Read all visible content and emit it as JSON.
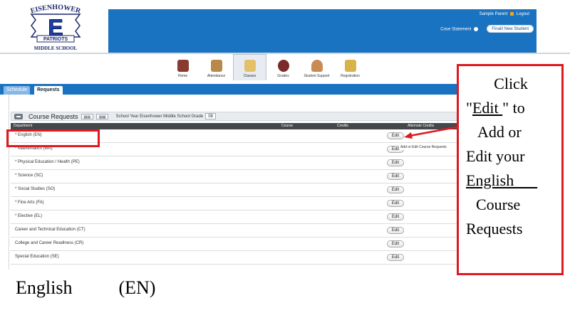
{
  "header": {
    "logo": {
      "name_top": "EISENHOWER",
      "mascot": "PATRIOTS",
      "name_bottom": "MIDDLE SCHOOL",
      "letter": "E"
    },
    "user": "Sample Parent",
    "logout": "Logout",
    "course_statement": "Cose Statement",
    "finalize_button": "Finalil New Student",
    "brand_color": "#1a73c1"
  },
  "nav": {
    "items": [
      {
        "label": "Home",
        "icon": "home-icon",
        "color": "#8a3b2f"
      },
      {
        "label": "Attendance",
        "icon": "attendance-icon",
        "color": "#b8894a"
      },
      {
        "label": "Classes",
        "icon": "classes-icon",
        "color": "#e5c06b"
      },
      {
        "label": "Grades",
        "icon": "grades-icon",
        "color": "#7a2a28"
      },
      {
        "label": "Student Support",
        "icon": "student-support-icon",
        "color": "#c98a56"
      },
      {
        "label": "Registration",
        "icon": "registration-icon",
        "color": "#d8b34a"
      }
    ]
  },
  "tabs": {
    "schedule": "Schedule",
    "requests": "Requests"
  },
  "course_requests": {
    "title": "Course Requests",
    "btn1": "▤▤",
    "btn2": "▤▤",
    "school_info": "School Year   Eisenhower Middle School   Grade",
    "grade": "08",
    "columns": {
      "department": "Department",
      "course": "Course",
      "credits": "Credits",
      "alternate": "Alternate Credits"
    },
    "edit_label": "Edit",
    "rows": [
      {
        "name": "* English (EN)"
      },
      {
        "name": "* Mathematics (MA)"
      },
      {
        "name": "* Physical Education / Health (PE)"
      },
      {
        "name": "* Science (SC)"
      },
      {
        "name": "* Social Studies (SO)"
      },
      {
        "name": "* Fine Arts (FA)"
      },
      {
        "name": "* Elective (EL)"
      },
      {
        "name": "Career and Technical Education (CT)"
      },
      {
        "name": "College and Career Readiness (CR)"
      },
      {
        "name": "Special Education (SE)"
      }
    ],
    "tooltip": "Add or Edit Course Requests"
  },
  "callout": {
    "line1": "Click",
    "line2a": "\"",
    "line2b": "Edit     ",
    "line2c": "\" to",
    "line3": "Add      or",
    "line4": "Edit    your",
    "line5": "English      ",
    "line6": "Course",
    "line7": "Requests",
    "color": "#e0181f"
  },
  "caption": "English          (EN)"
}
